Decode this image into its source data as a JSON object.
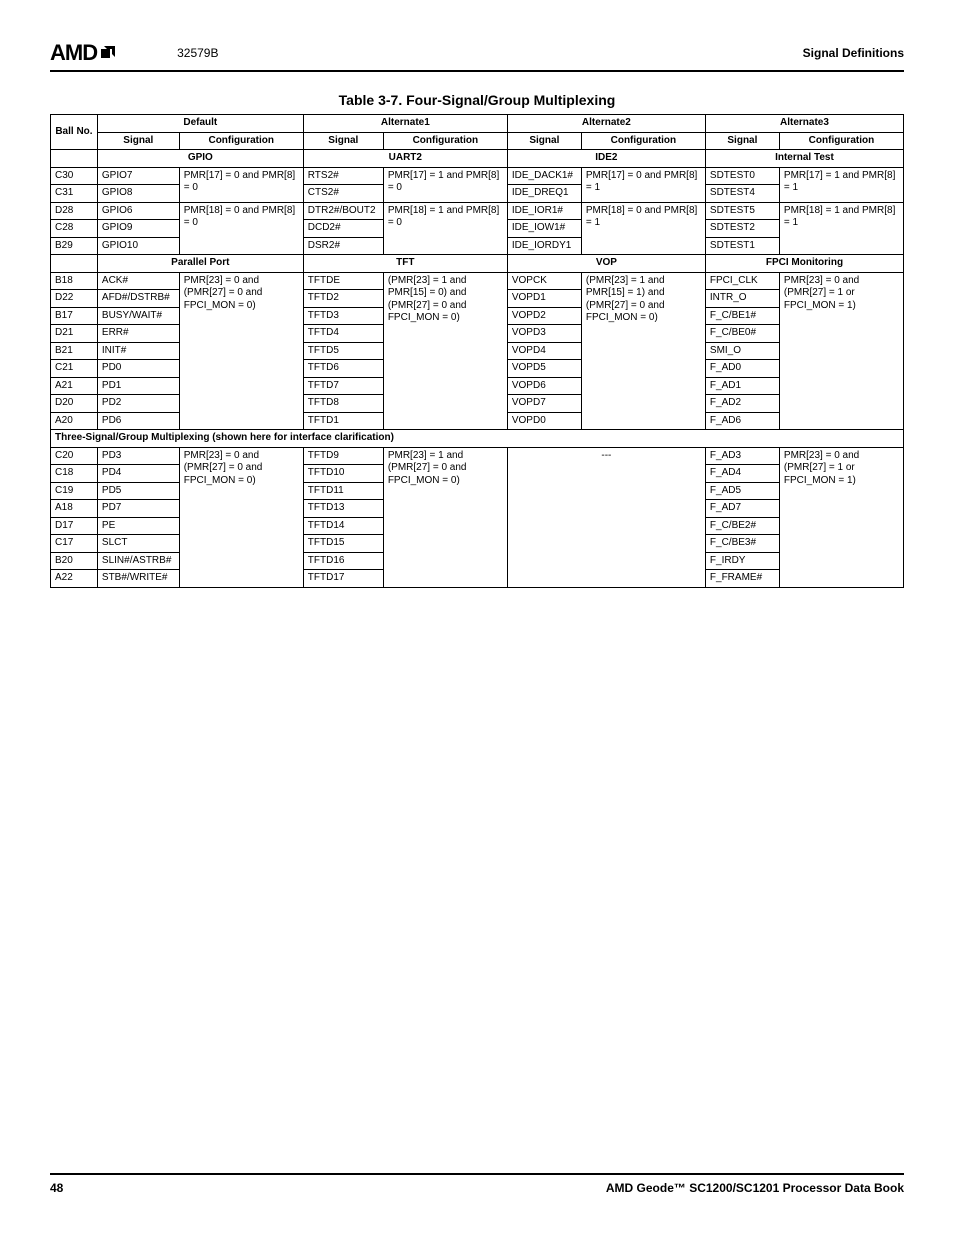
{
  "header": {
    "brand": "AMD",
    "docnum": "32579B",
    "section": "Signal Definitions"
  },
  "table_caption": "Table 3-7.  Four-Signal/Group Multiplexing",
  "columns": {
    "ball": "Ball No.",
    "default": "Default",
    "alt1": "Alternate1",
    "alt2": "Alternate2",
    "alt3": "Alternate3",
    "signal": "Signal",
    "config": "Configuration"
  },
  "group1": {
    "default": "GPIO",
    "alt1": "UART2",
    "alt2": "IDE2",
    "alt3": "Internal Test"
  },
  "g1_cfg": {
    "default_a": "PMR[17] = 0 and PMR[8] = 0",
    "alt1_a": "PMR[17] = 1 and PMR[8] = 0",
    "alt2_a": "PMR[17] = 0 and PMR[8] = 1",
    "alt3_a": "PMR[17] = 1 and PMR[8] = 1",
    "default_b": "PMR[18] = 0 and PMR[8] = 0",
    "alt1_b": "PMR[18] = 1 and PMR[8] = 0",
    "alt2_b": "PMR[18] = 0 and PMR[8] = 1",
    "alt3_b": "PMR[18] = 1 and PMR[8] = 1"
  },
  "g1_rows": [
    {
      "ball": "C30",
      "d": "GPIO7",
      "a1": "RTS2#",
      "a2": "IDE_DACK1#",
      "a3": "SDTEST0"
    },
    {
      "ball": "C31",
      "d": "GPIO8",
      "a1": "CTS2#",
      "a2": "IDE_DREQ1",
      "a3": "SDTEST4"
    },
    {
      "ball": "D28",
      "d": "GPIO6",
      "a1": "DTR2#/BOUT2",
      "a2": "IDE_IOR1#",
      "a3": "SDTEST5"
    },
    {
      "ball": "C28",
      "d": "GPIO9",
      "a1": "DCD2#",
      "a2": "IDE_IOW1#",
      "a3": "SDTEST2"
    },
    {
      "ball": "B29",
      "d": "GPIO10",
      "a1": "DSR2#",
      "a2": "IDE_IORDY1",
      "a3": "SDTEST1"
    }
  ],
  "group2": {
    "default": "Parallel Port",
    "alt1": "TFT",
    "alt2": "VOP",
    "alt3": "FPCI Monitoring"
  },
  "g2_cfg": {
    "default": "PMR[23] = 0 and (PMR[27] = 0 and FPCI_MON = 0)",
    "alt1": "(PMR[23] = 1 and PMR[15] = 0) and (PMR[27] = 0 and FPCI_MON = 0)",
    "alt2": "(PMR[23] = 1 and PMR[15] = 1) and (PMR[27] = 0 and FPCI_MON = 0)",
    "alt3": "PMR[23] = 0 and (PMR[27] = 1 or FPCI_MON = 1)"
  },
  "g2_rows": [
    {
      "ball": "B18",
      "d": "ACK#",
      "a1": "TFTDE",
      "a2": "VOPCK",
      "a3": "FPCI_CLK"
    },
    {
      "ball": "D22",
      "d": "AFD#/DSTRB#",
      "a1": "TFTD2",
      "a2": "VOPD1",
      "a3": "INTR_O"
    },
    {
      "ball": "B17",
      "d": "BUSY/WAIT#",
      "a1": "TFTD3",
      "a2": "VOPD2",
      "a3": "F_C/BE1#"
    },
    {
      "ball": "D21",
      "d": "ERR#",
      "a1": "TFTD4",
      "a2": "VOPD3",
      "a3": "F_C/BE0#"
    },
    {
      "ball": "B21",
      "d": "INIT#",
      "a1": "TFTD5",
      "a2": "VOPD4",
      "a3": "SMI_O"
    },
    {
      "ball": "C21",
      "d": "PD0",
      "a1": "TFTD6",
      "a2": "VOPD5",
      "a3": "F_AD0"
    },
    {
      "ball": "A21",
      "d": "PD1",
      "a1": "TFTD7",
      "a2": "VOPD6",
      "a3": "F_AD1"
    },
    {
      "ball": "D20",
      "d": "PD2",
      "a1": "TFTD8",
      "a2": "VOPD7",
      "a3": "F_AD2"
    },
    {
      "ball": "A20",
      "d": "PD6",
      "a1": "TFTD1",
      "a2": "VOPD0",
      "a3": "F_AD6"
    }
  ],
  "section_note": "Three-Signal/Group Multiplexing (shown here for interface clarification)",
  "g3_cfg": {
    "default": "PMR[23] = 0 and (PMR[27] = 0 and FPCI_MON = 0)",
    "alt1": "PMR[23] = 1 and (PMR[27] = 0 and FPCI_MON = 0)",
    "alt2": "---",
    "alt3": "PMR[23] = 0 and (PMR[27] = 1 or FPCI_MON = 1)"
  },
  "g3_rows": [
    {
      "ball": "C20",
      "d": "PD3",
      "a1": "TFTD9",
      "a3": "F_AD3"
    },
    {
      "ball": "C18",
      "d": "PD4",
      "a1": "TFTD10",
      "a3": "F_AD4"
    },
    {
      "ball": "C19",
      "d": "PD5",
      "a1": "TFTD11",
      "a3": "F_AD5"
    },
    {
      "ball": "A18",
      "d": "PD7",
      "a1": "TFTD13",
      "a3": "F_AD7"
    },
    {
      "ball": "D17",
      "d": "PE",
      "a1": "TFTD14",
      "a3": "F_C/BE2#"
    },
    {
      "ball": "C17",
      "d": "SLCT",
      "a1": "TFTD15",
      "a3": "F_C/BE3#"
    },
    {
      "ball": "B20",
      "d": "SLIN#/ASTRB#",
      "a1": "TFTD16",
      "a3": "F_IRDY"
    },
    {
      "ball": "A22",
      "d": "STB#/WRITE#",
      "a1": "TFTD17",
      "a3": "F_FRAME#"
    }
  ],
  "footer": {
    "page": "48",
    "book": "AMD Geode™ SC1200/SC1201 Processor Data Book"
  }
}
